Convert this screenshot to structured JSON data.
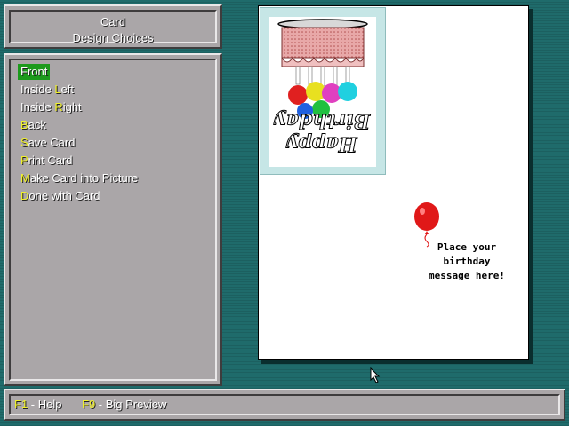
{
  "header": {
    "line1": "Card",
    "line2": "Design Choices"
  },
  "menu": {
    "items": [
      {
        "hot": "F",
        "rest": "ront"
      },
      {
        "pre": "Inside ",
        "hot": "L",
        "rest": "eft"
      },
      {
        "pre": "Inside ",
        "hot": "R",
        "rest": "ight"
      },
      {
        "hot": "B",
        "rest": "ack"
      },
      {
        "hot": "S",
        "rest": "ave Card"
      },
      {
        "hot": "P",
        "rest": "rint Card"
      },
      {
        "hot": "M",
        "rest": "ake Card into Picture"
      },
      {
        "hot": "D",
        "rest": "one with Card"
      }
    ],
    "selected_index": 0
  },
  "statusbar": {
    "f1_key": "F1",
    "f1_label": " - Help",
    "f9_key": "F9",
    "f9_label": " - Big Preview"
  },
  "card": {
    "front_text_line1": "Happy",
    "front_text_line2": "Birthday",
    "message": "Place your birthday message here!"
  },
  "colors": {
    "background": "#1f6b6b",
    "panel": "#aaa6a8",
    "highlight": "#1c9a1c",
    "hotkey": "#f2f22a",
    "balloon": "#e01818"
  },
  "icons": {
    "cursor": "arrow-pointer-icon",
    "balloon": "red-balloon-icon"
  }
}
